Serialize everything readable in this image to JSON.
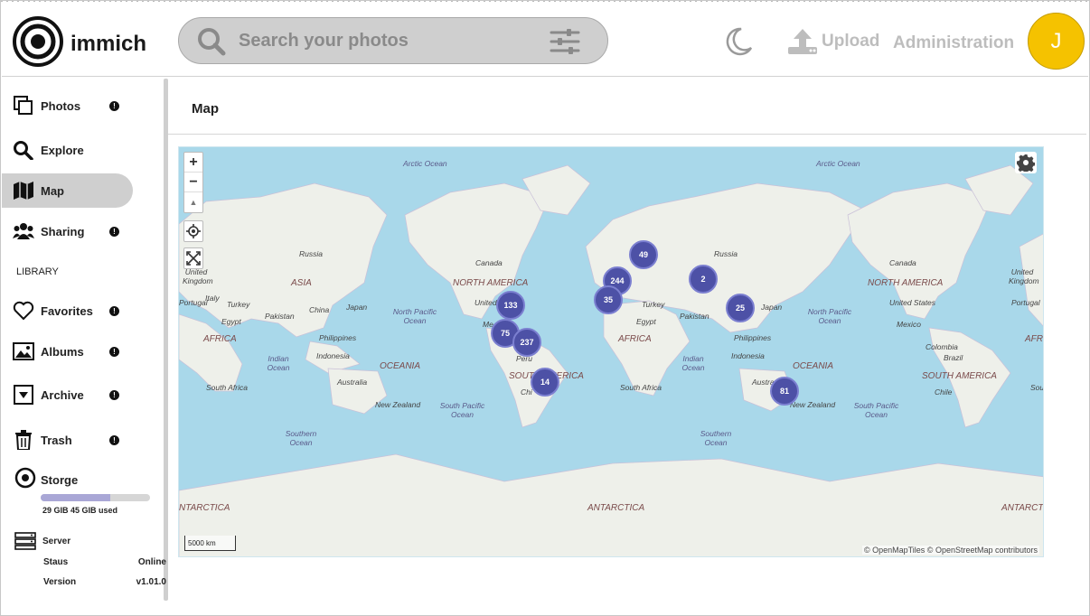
{
  "app": {
    "name": "immich"
  },
  "header": {
    "search_placeholder": "Search your photos",
    "upload_label": "Upload",
    "admin_label": "Administration",
    "avatar_initial": "J"
  },
  "sidebar": {
    "items": [
      {
        "label": "Photos",
        "icon": "photos-icon",
        "badge": "!"
      },
      {
        "label": "Explore",
        "icon": "search-icon"
      },
      {
        "label": "Map",
        "icon": "map-icon",
        "active": true
      },
      {
        "label": "Sharing",
        "icon": "people-icon",
        "badge": "!"
      }
    ],
    "library_heading": "LIBRARY",
    "library_items": [
      {
        "label": "Favorites",
        "icon": "heart-icon",
        "badge": "!"
      },
      {
        "label": "Albums",
        "icon": "image-icon",
        "badge": "!"
      },
      {
        "label": "Archive",
        "icon": "archive-icon",
        "badge": "!"
      },
      {
        "label": "Trash",
        "icon": "trash-icon",
        "badge": "!"
      }
    ],
    "storage": {
      "label": "Storge",
      "used_text": "29 GIB 45 GIB used",
      "fraction": 0.64
    },
    "server": {
      "label": "Server",
      "status_label": "Staus",
      "status_value": "Online",
      "version_label": "Version",
      "version_value": "v1.01.0"
    }
  },
  "main": {
    "title": "Map",
    "map": {
      "zoom_in": "+",
      "zoom_out": "−",
      "compass": "▲",
      "scale_label": "5000 km",
      "attribution": "© OpenMapTiles © OpenStreetMap contributors",
      "clusters": [
        {
          "count": "49"
        },
        {
          "count": "244"
        },
        {
          "count": "2"
        },
        {
          "count": "35"
        },
        {
          "count": "133"
        },
        {
          "count": "25"
        },
        {
          "count": "75"
        },
        {
          "count": "237"
        },
        {
          "count": "14"
        },
        {
          "count": "81"
        }
      ],
      "labels": {
        "arctic1": "Arctic Ocean",
        "arctic2": "Arctic Ocean",
        "russia1": "Russia",
        "russia2": "Russia",
        "canada1": "Canada",
        "canada2": "Canada",
        "asia": "ASIA",
        "china": "China",
        "japan1": "Japan",
        "japan2": "Japan",
        "na1": "NORTH AMERICA",
        "na2": "NORTH AMERICA",
        "us1": "United",
        "us2": "United States",
        "npo1": "North Pacific Ocean",
        "npo2": "North Pacific Ocean",
        "uk1": "United Kingdom",
        "uk2": "United Kingdom",
        "portugal1": "Portugal",
        "portugal2": "Portugal",
        "turkey1": "Turkey",
        "turkey2": "Turkey",
        "italy": "Italy",
        "egypt1": "Egypt",
        "egypt2": "Egypt",
        "pakistan1": "Pakistan",
        "pakistan2": "Pakistan",
        "africa1": "AFRICA",
        "africa2": "AFRICA",
        "africa3": "AFRI",
        "philippines1": "Philippines",
        "philippines2": "Philippines",
        "indian1": "Indian Ocean",
        "indian2": "Indian Ocean",
        "indonesia1": "Indonesia",
        "indonesia2": "Indonesia",
        "oceania1": "OCEANIA",
        "oceania2": "OCEANIA",
        "australia1": "Australia",
        "australia2": "Austra",
        "mexico1": "Me",
        "mexico2": "Mexico",
        "colombia": "Colombia",
        "brazil": "Brazil",
        "peru": "Peru",
        "sa1": "SOUTH AMERICA",
        "sa2": "SOUTH AMERICA",
        "chile1": "Chi",
        "chile2": "Chile",
        "sa_af1": "South Africa",
        "sa_af2": "South Africa",
        "sa_af3": "Sou",
        "nz1": "New Zealand",
        "nz2": "New Zealand",
        "spo1": "South Pacific Ocean",
        "spo2": "South Pacific Ocean",
        "so1": "Southern Ocean",
        "so2": "Southern Ocean",
        "antarctica1": "NTARCTICA",
        "antarctica2": "ANTARCTICA",
        "antarctica3": "ANTARCTIC"
      }
    }
  }
}
